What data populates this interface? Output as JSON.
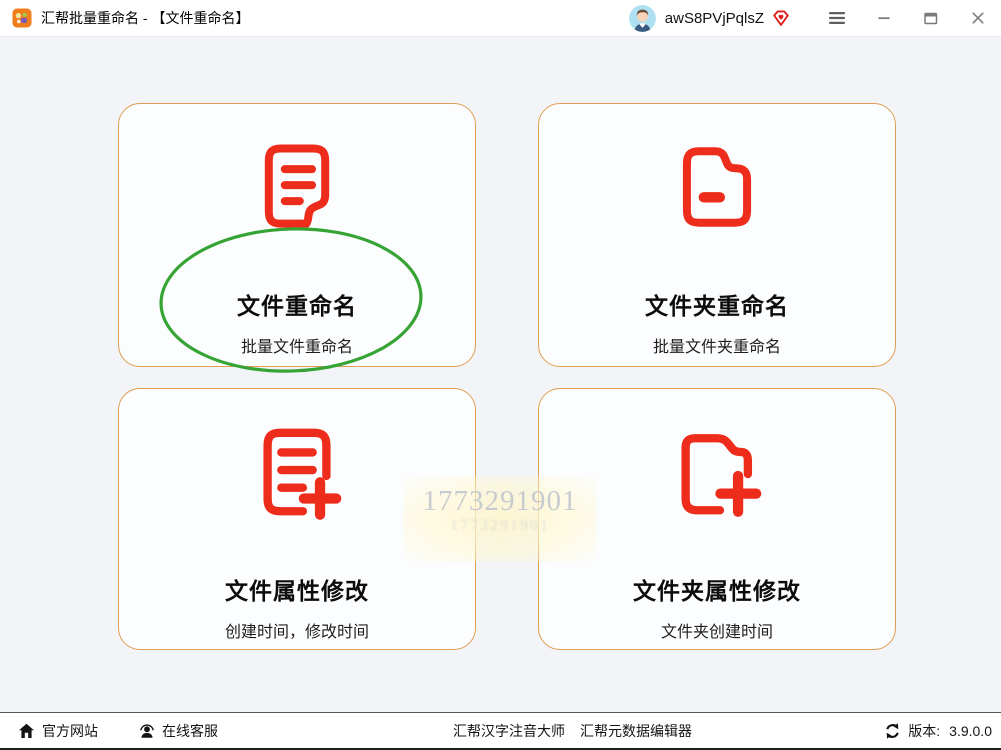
{
  "titlebar": {
    "title": "汇帮批量重命名 - 【文件重命名】",
    "username": "awS8PVjPqlsZ"
  },
  "cards": [
    {
      "title": "文件重命名",
      "subtitle": "批量文件重命名"
    },
    {
      "title": "文件夹重命名",
      "subtitle": "批量文件夹重命名"
    },
    {
      "title": "文件属性修改",
      "subtitle": "创建时间，修改时间"
    },
    {
      "title": "文件夹属性修改",
      "subtitle": "文件夹创建时间"
    }
  ],
  "watermark": {
    "line1": "1773291901",
    "line2": "1773291901"
  },
  "footer": {
    "official_site": "官方网站",
    "online_service": "在线客服",
    "pinyin_app": "汇帮汉字注音大师",
    "metadata_app": "汇帮元数据编辑器",
    "version_label": "版本:",
    "version_value": "3.9.0.0"
  },
  "colors": {
    "icon_red": "#EE2C1B",
    "card_border": "#E09D52",
    "annotation_green": "#35A435",
    "background": "#F2F4F8"
  }
}
